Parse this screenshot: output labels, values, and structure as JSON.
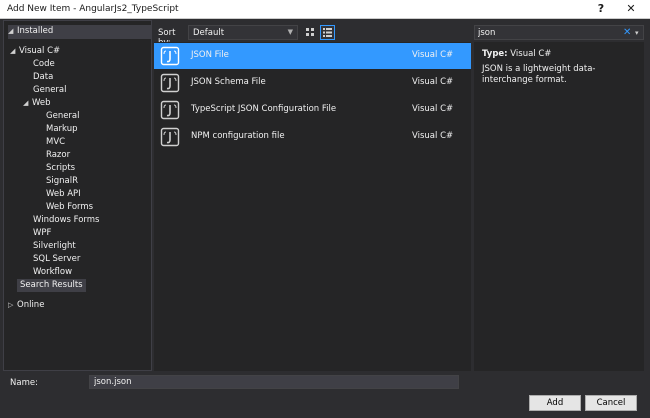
{
  "window": {
    "title": "Add New Item - AngularJs2_TypeScript",
    "help": "?",
    "close": "✕"
  },
  "tree": {
    "installed": "Installed",
    "online": "Online",
    "items": [
      {
        "label": "Visual C#"
      },
      {
        "label": "Code"
      },
      {
        "label": "Data"
      },
      {
        "label": "General"
      },
      {
        "label": "Web"
      },
      {
        "label": "General"
      },
      {
        "label": "Markup"
      },
      {
        "label": "MVC"
      },
      {
        "label": "Razor"
      },
      {
        "label": "Scripts"
      },
      {
        "label": "SignalR"
      },
      {
        "label": "Web API"
      },
      {
        "label": "Web Forms"
      },
      {
        "label": "Windows Forms"
      },
      {
        "label": "WPF"
      },
      {
        "label": "Silverlight"
      },
      {
        "label": "SQL Server"
      },
      {
        "label": "Workflow"
      },
      {
        "label": "Search Results"
      }
    ]
  },
  "toolbar": {
    "sort_label": "Sort by:",
    "sort_value": "Default"
  },
  "search": {
    "value": "json",
    "clear": "✕",
    "dropdown": "▾"
  },
  "templates": [
    {
      "name": "JSON File",
      "lang": "Visual C#"
    },
    {
      "name": "JSON Schema File",
      "lang": "Visual C#"
    },
    {
      "name": "TypeScript JSON Configuration File",
      "lang": "Visual C#"
    },
    {
      "name": "NPM configuration file",
      "lang": "Visual C#"
    }
  ],
  "details": {
    "type_label": "Type:",
    "type_value": "Visual C#",
    "description": "JSON is a lightweight data-interchange format."
  },
  "footer": {
    "name_label": "Name:",
    "name_value": "json.json",
    "add_label": "Add",
    "cancel_label": "Cancel"
  },
  "colors": {
    "selection": "#3399ff",
    "background": "#2d2d30",
    "pane": "#252526"
  }
}
